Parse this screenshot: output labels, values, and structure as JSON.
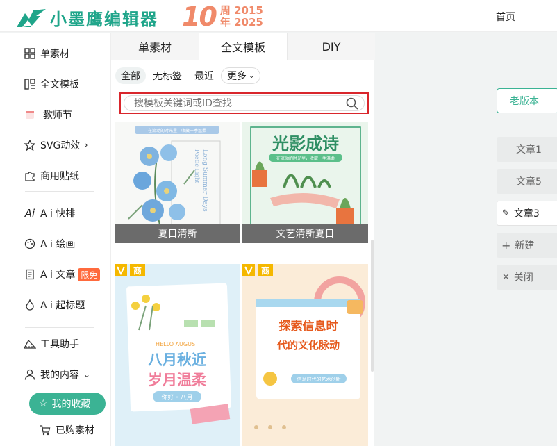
{
  "header": {
    "logo_text": "小墨鹰编辑器",
    "anniv_num": "10",
    "anniv_line1": "周 2015",
    "anniv_line2": "年 2025",
    "nav_home": "首页"
  },
  "sidebar": {
    "items": [
      {
        "label": "单素材",
        "icon": "grid-icon"
      },
      {
        "label": "全文模板",
        "icon": "layout-icon"
      },
      {
        "label": "教师节",
        "icon": "calendar-icon"
      },
      {
        "label": "SVG动效",
        "icon": "star-outline-icon"
      },
      {
        "label": "商用贴纸",
        "icon": "puzzle-icon"
      },
      {
        "label": "A i 快排",
        "icon": "ai-icon"
      },
      {
        "label": "A i 绘画",
        "icon": "palette-icon"
      },
      {
        "label": "A i 文章",
        "icon": "document-icon"
      },
      {
        "label": "A i 起标题",
        "icon": "flame-icon"
      },
      {
        "label": "工具助手",
        "icon": "ruler-icon"
      },
      {
        "label": "我的内容",
        "icon": "user-icon"
      }
    ],
    "ai_article_badge": "限免",
    "collect_label": "我的收藏",
    "purchased_label": "已购素材"
  },
  "panel": {
    "tabs": [
      "单素材",
      "全文模板",
      "DIY"
    ],
    "active_tab": "全文模板",
    "filters": [
      "全部",
      "无标签",
      "最近",
      "更多"
    ],
    "search_placeholder": "搜模板关键词或ID查找",
    "cards": [
      {
        "caption": "夏日清新",
        "art_title": "Long Summer Days",
        "art_sub": "Poetic Light",
        "art_banner": "在流动的时光里，收藏一季温柔"
      },
      {
        "caption": "文艺清新夏日",
        "art_title": "光影成诗",
        "art_banner": "在流动的时光里，收藏一季温柔"
      },
      {
        "caption": "",
        "badge": "商",
        "art_small": "HELLO AUGUST",
        "art_line1": "八月秋近",
        "art_line2": "岁月温柔",
        "art_foot": "你好・八月"
      },
      {
        "caption": "",
        "badge": "商",
        "art_line1": "探索信息时",
        "art_line2": "代的文化脉动",
        "art_foot": "信息时代的艺术创新"
      }
    ]
  },
  "right": {
    "old_version": "老版本",
    "articles": [
      "文章1",
      "文章5",
      "文章3"
    ],
    "active_article": "文章3",
    "new_label": "新建",
    "close_label": "关闭"
  }
}
